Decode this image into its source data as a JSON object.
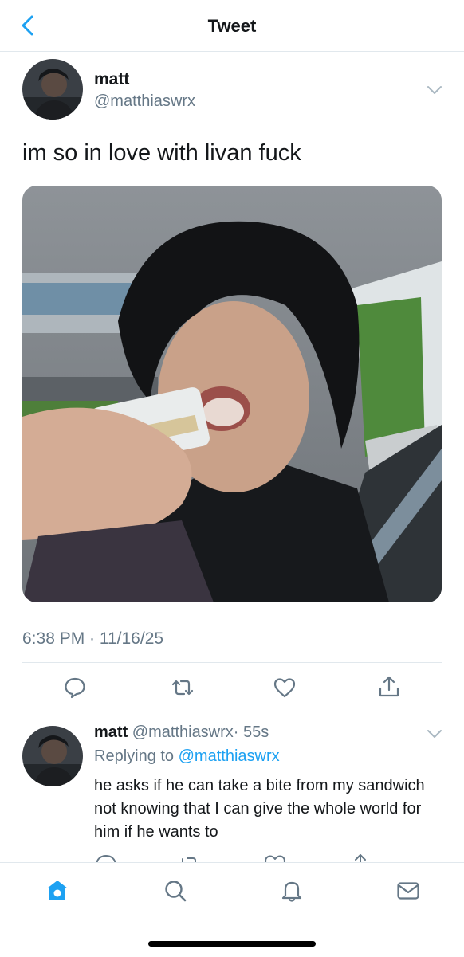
{
  "header": {
    "title": "Tweet"
  },
  "tweet": {
    "name": "matt",
    "handle": "@matthiaswrx",
    "text": "im so in love with livan fuck",
    "timestamp": "6:38 PM · 11/16/25"
  },
  "reply": {
    "name": "matt",
    "handle": "@matthiaswrx",
    "age": "· 55s",
    "replying_prefix": "Replying to",
    "replying_to": "@matthiaswrx",
    "text": "he asks if he can take a bite from my sandwich not knowing that I can give the whole world for him if he wants to"
  },
  "icons": {
    "back": "chevron-left-icon",
    "caret": "chevron-down-icon",
    "reply": "comment-icon",
    "retweet": "retweet-icon",
    "like": "heart-icon",
    "share": "share-icon",
    "tabs": [
      "home-icon",
      "search-icon",
      "notifications-icon",
      "messages-icon"
    ]
  },
  "colors": {
    "accent": "#1da1f2",
    "secondary_text": "#657786",
    "divider": "#e1e8ed"
  }
}
